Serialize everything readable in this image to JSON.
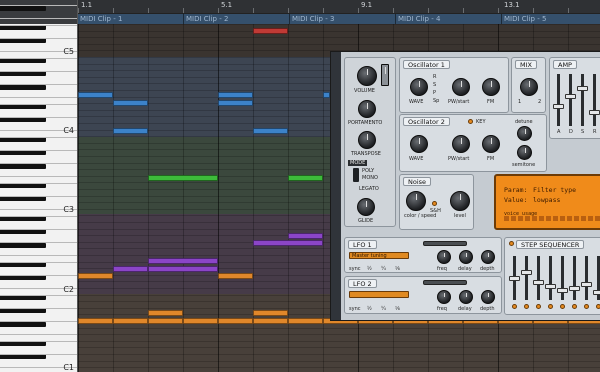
{
  "ruler": {
    "marks": [
      "1.1",
      "5.1",
      "9.1",
      "13.1"
    ]
  },
  "clips": [
    "MIDI Clip - 1",
    "MIDI Clip - 2",
    "MIDI Clip - 3",
    "MIDI Clip - 4",
    "MIDI Clip - 5"
  ],
  "piano": {
    "octaves": [
      "C5",
      "C4",
      "C3",
      "C2",
      "C1"
    ]
  },
  "colors": {
    "blue": "#3c82c9",
    "red": "#c03a35",
    "green": "#3dbb3a",
    "purple": "#8b45c7",
    "orange": "#e0872a"
  },
  "synth": {
    "osc1": {
      "title": "Oscillator 1",
      "wave": "WAVE",
      "pw": "PW/start",
      "fm": "FM",
      "waves": [
        "N",
        "R",
        "S",
        "P",
        "Sp",
        "SL",
        "SL2"
      ]
    },
    "osc2": {
      "title": "Oscillator 2",
      "key": "KEY",
      "wave": "WAVE",
      "pw": "PW/start",
      "fm": "FM",
      "detune": "detune",
      "semitone": "semitone",
      "waves": [
        "N",
        "R",
        "S",
        "P",
        "Sp"
      ]
    },
    "mix": {
      "title": "MIX",
      "a": "1",
      "b": "2"
    },
    "amp": {
      "title": "AMP",
      "labels": [
        "A",
        "D",
        "S",
        "R"
      ]
    },
    "global": {
      "volume": "VOLUME",
      "portamento": "PORTAMENTO",
      "transpose": "TRANSPOSE",
      "mode": "MODE",
      "poly": "POLY",
      "mono": "MONO",
      "legato": "LEGATO",
      "glide": "GLIDE"
    },
    "noise": {
      "title": "Noise",
      "color": "color / speed",
      "sh": "S&H",
      "level": "level"
    },
    "lcd": {
      "param_label": "Param:",
      "param_value": "Filter type",
      "value_label": "Value:",
      "value_value": "lowpass",
      "voices": "voice usage"
    },
    "lfo1": {
      "title": "LFO 1",
      "target": "Master tuning",
      "labels": [
        "sync",
        "½",
        "¼",
        "⅛",
        "freq",
        "delay",
        "depth"
      ]
    },
    "lfo2": {
      "title": "LFO 2",
      "target": "",
      "labels": [
        "sync",
        "½",
        "¼",
        "⅛",
        "freq",
        "delay",
        "depth"
      ]
    },
    "seq": {
      "title": "STEP SEQUENCER"
    }
  }
}
